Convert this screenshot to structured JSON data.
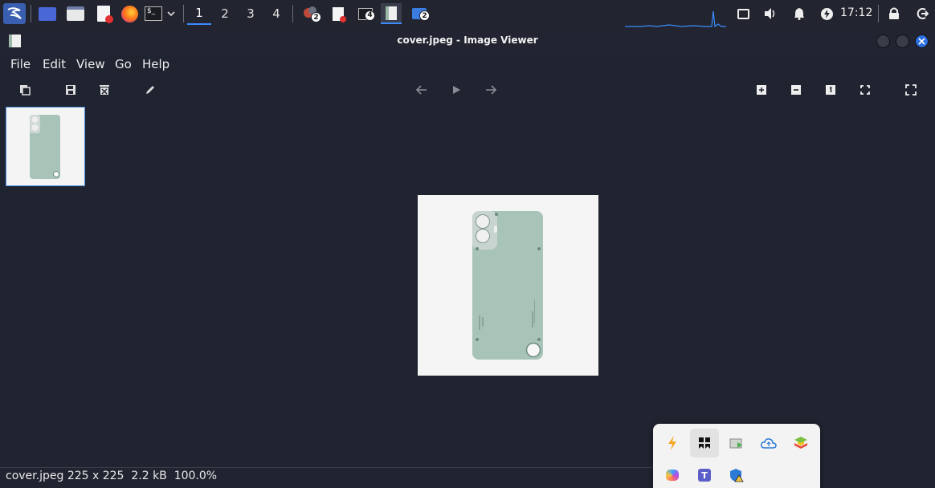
{
  "panel": {
    "workspaces": [
      "1",
      "2",
      "3",
      "4"
    ],
    "active_workspace": "1",
    "task_badges": [
      "2",
      "4",
      "2"
    ],
    "clock": "17:12",
    "icons": [
      "kali-menu-icon",
      "desktop-icon",
      "file-manager-icon",
      "text-editor-icon",
      "firefox-icon",
      "terminal-icon",
      "dropdown-icon",
      "mixed-app-icon",
      "editor-task-icon",
      "terminal-task-icon",
      "image-viewer-task-icon",
      "folder-task-icon",
      "cpu-graph-icon",
      "network-icon",
      "volume-icon",
      "bell-icon",
      "power-manager-icon",
      "lock-icon",
      "logout-icon"
    ]
  },
  "window": {
    "title": "cover.jpeg - Image Viewer"
  },
  "menu": [
    "File",
    "Edit",
    "View",
    "Go",
    "Help"
  ],
  "toolbar": {
    "left": [
      "copy-icon",
      "save-icon",
      "delete-icon",
      "edit-icon"
    ],
    "center": [
      "back-arrow-icon",
      "play-icon",
      "forward-arrow-icon"
    ],
    "right": [
      "zoom-in-icon",
      "zoom-out-icon",
      "zoom-100-icon",
      "zoom-fit-icon",
      "fullscreen-icon"
    ]
  },
  "status": {
    "filename": "cover.jpeg",
    "dimensions": "225 x 225",
    "size": "2.2 kB",
    "zoom": "100.0%"
  },
  "tray_popup": {
    "icons": [
      "bolt-icon",
      "bookmark-app-icon",
      "screen-share-icon",
      "cloud-sync-icon",
      "stacked-app-icon",
      "copilot-icon",
      "teams-icon",
      "defender-warning-icon"
    ]
  },
  "colors": {
    "accent": "#3a8cff",
    "background": "#202330",
    "phone_body": "#a8c4b8"
  }
}
